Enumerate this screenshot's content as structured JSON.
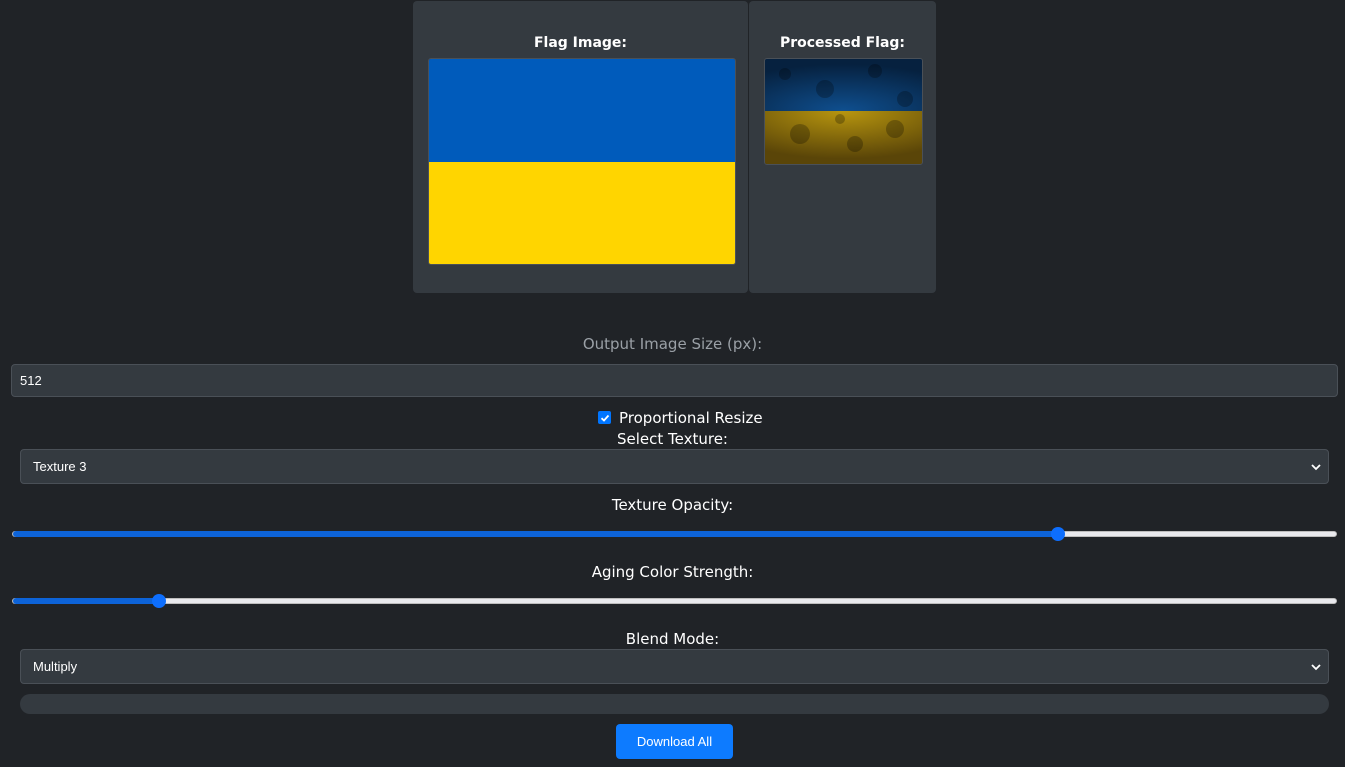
{
  "preview": {
    "original_title": "Flag Image:",
    "processed_title": "Processed Flag:",
    "flag_colors": {
      "top": "#005bbb",
      "bottom": "#ffd500"
    },
    "processed_colors": {
      "top": "#0a3f73",
      "bottom": "#a88a10"
    }
  },
  "controls": {
    "size_label": "Output Image Size (px):",
    "size_value": "512",
    "proportional_label": "Proportional Resize",
    "proportional_checked": true,
    "texture_label": "Select Texture:",
    "texture_value": "Texture 3",
    "opacity_label": "Texture Opacity:",
    "opacity_value": 0.79,
    "aging_label": "Aging Color Strength:",
    "aging_value": 0.11,
    "blend_label": "Blend Mode:",
    "blend_value": "Multiply",
    "progress_value": 0,
    "download_label": "Download All"
  },
  "colors": {
    "background": "#202327",
    "panel": "#343a40",
    "accent": "#0d6efd"
  }
}
